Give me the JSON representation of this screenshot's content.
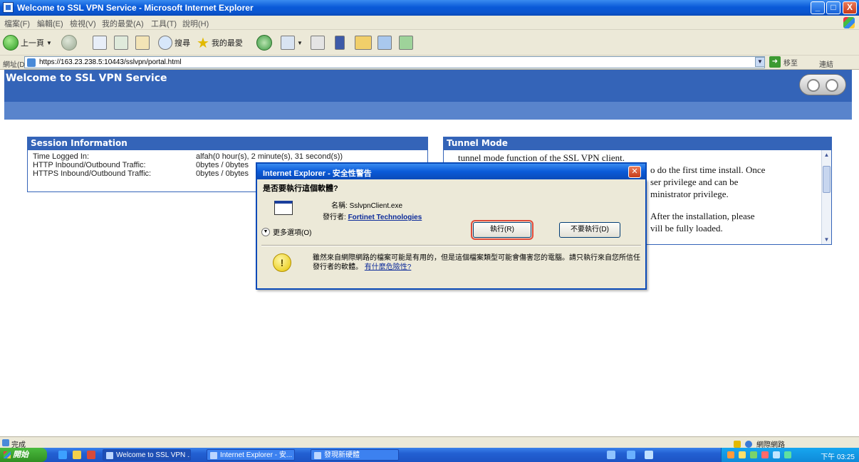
{
  "window": {
    "title": "Welcome to SSL VPN Service - Microsoft Internet Explorer",
    "min_label": "_",
    "max_label": "□",
    "close_label": "X"
  },
  "menu": [
    "檔案(F)",
    "編輯(E)",
    "檢視(V)",
    "我的最愛(A)",
    "工具(T)",
    "說明(H)"
  ],
  "toolbar": {
    "back_label": "上一頁",
    "search_label": "搜尋",
    "favorites_label": "我的最愛"
  },
  "address": {
    "label": "網址(D)",
    "url": "https://163.23.238.5:10443/sslvpn/portal.html",
    "go_label": "移至",
    "links_label": "連結"
  },
  "page": {
    "welcome": "Welcome to SSL VPN Service",
    "session": {
      "heading": "Session Information",
      "rows": [
        {
          "label": "Time Logged In:",
          "value": "alfah(0 hour(s), 2 minute(s), 31 second(s))"
        },
        {
          "label": "HTTP Inbound/Outbound Traffic:",
          "value": "0bytes / 0bytes"
        },
        {
          "label": "HTTPS Inbound/Outbound Traffic:",
          "value": "0bytes / 0bytes"
        }
      ]
    },
    "tunnel": {
      "heading": "Tunnel Mode",
      "lines": [
        "tunnel mode function of the SSL VPN client.",
        "o do the first time install. Once",
        "ser privilege and can be",
        "ministrator privilege.",
        "After the installation, please",
        "vill be fully loaded."
      ]
    }
  },
  "dialog": {
    "title": "Internet Explorer - 安全性警告",
    "question": "是否要執行這個軟體?",
    "name_label": "名稱:",
    "name_value": "SslvpnClient.exe",
    "publisher_label": "發行者:",
    "publisher_value": "Fortinet Technologies",
    "more_options": "更多選項(O)",
    "run_button": "執行(R)",
    "dont_run_button": "不要執行(D)",
    "warning": "雖然來自網際網路的檔案可能是有用的，但是這個檔案類型可能會傷害您的電腦。請只執行來自您所信任發行者的軟體。",
    "risk_link": "有什麼危險性?"
  },
  "status": {
    "left": "完成",
    "right": "網際網路"
  },
  "taskbar": {
    "start": "開始",
    "tasks": [
      "Welcome to SSL VPN ...",
      "Internet Explorer - 安...",
      "發現新硬體"
    ],
    "clock": "下午 03:25"
  }
}
